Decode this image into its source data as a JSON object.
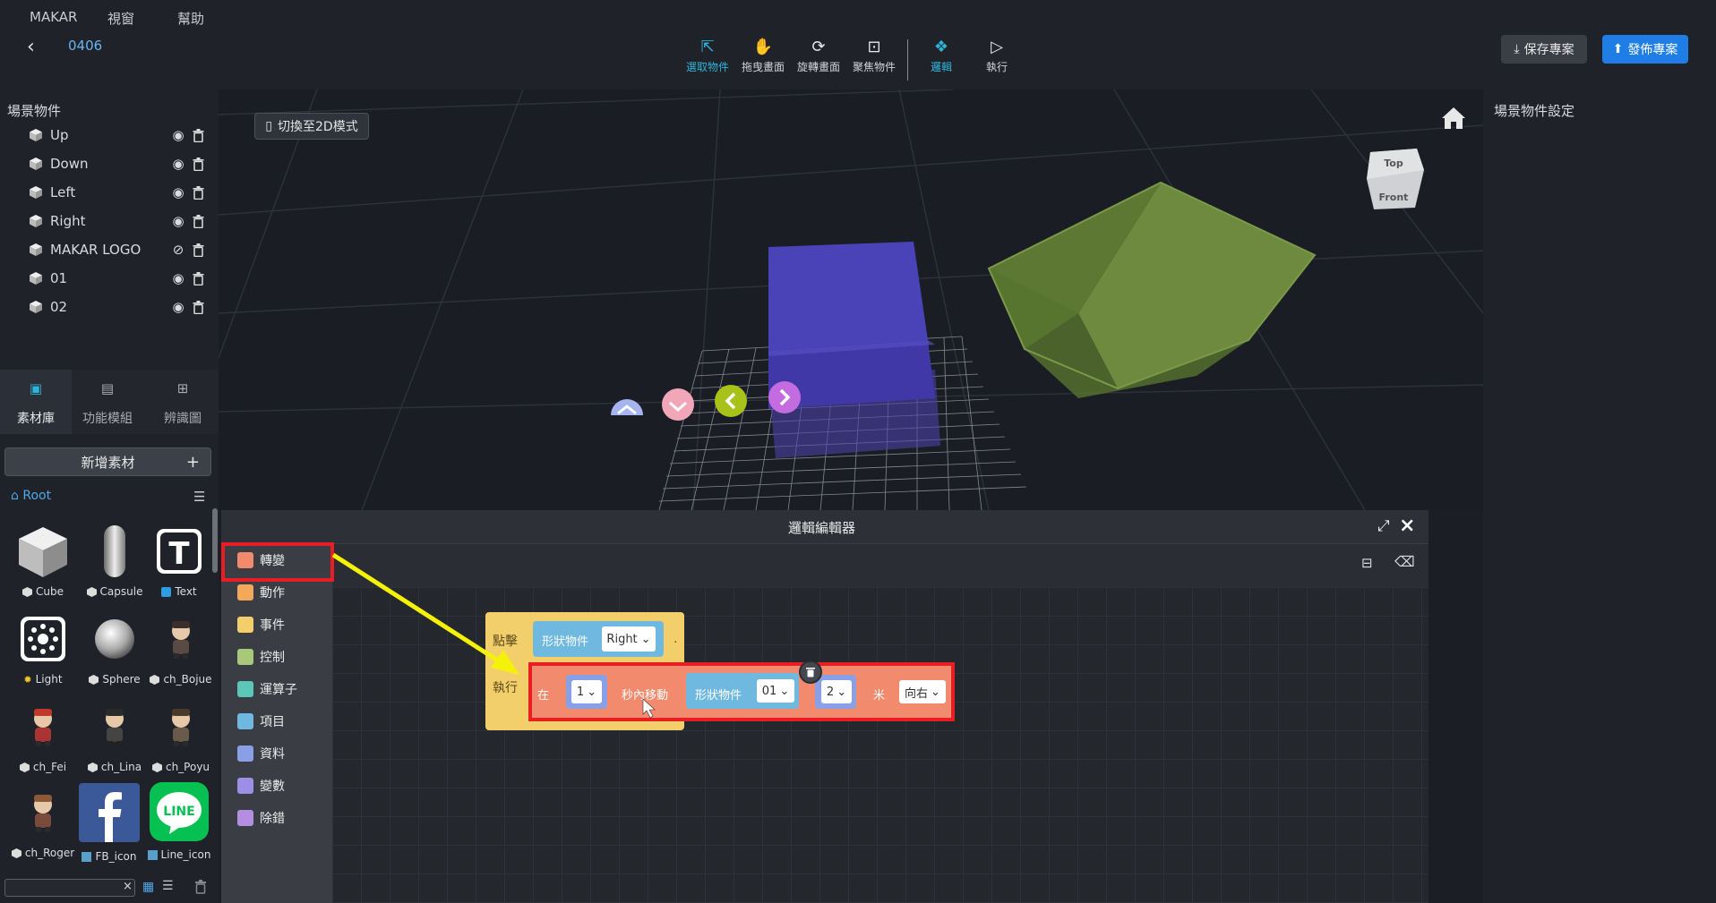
{
  "menu": [
    "MAKAR",
    "視窗",
    "幫助"
  ],
  "project": {
    "name": "0406"
  },
  "toolbar": {
    "tools": [
      {
        "label": "選取物件",
        "icon": "cursor-icon",
        "active": true
      },
      {
        "label": "拖曳畫面",
        "icon": "hand-icon"
      },
      {
        "label": "旋轉畫面",
        "icon": "rotate-icon"
      },
      {
        "label": "聚焦物件",
        "icon": "focus-icon"
      },
      {
        "label": "邏輯",
        "icon": "logic-icon",
        "active": true
      },
      {
        "label": "執行",
        "icon": "play-icon"
      }
    ],
    "save_label": "保存專案",
    "publish_label": "發佈專案"
  },
  "scene": {
    "title": "場景物件",
    "objects": [
      {
        "name": "Up",
        "visible": true
      },
      {
        "name": "Down",
        "visible": true
      },
      {
        "name": "Left",
        "visible": true
      },
      {
        "name": "Right",
        "visible": true
      },
      {
        "name": "MAKAR LOGO",
        "visible": false
      },
      {
        "name": "01",
        "visible": true
      },
      {
        "name": "02",
        "visible": true
      }
    ]
  },
  "library": {
    "tabs": [
      "素材庫",
      "功能模組",
      "辨識圖"
    ],
    "add_label": "新增素材",
    "root_label": "Root",
    "assets": [
      {
        "name": "Cube"
      },
      {
        "name": "Capsule"
      },
      {
        "name": "Text"
      },
      {
        "name": "Light"
      },
      {
        "name": "Sphere"
      },
      {
        "name": "ch_Bojue"
      },
      {
        "name": "ch_Fei"
      },
      {
        "name": "ch_Lina"
      },
      {
        "name": "ch_Poyu"
      },
      {
        "name": "ch_Roger"
      },
      {
        "name": "FB_icon"
      },
      {
        "name": "Line_icon"
      }
    ]
  },
  "viewport": {
    "switch_label": "切換至2D模式",
    "viewcube": {
      "top": "Top",
      "front": "Front"
    }
  },
  "properties": {
    "title": "場景物件設定"
  },
  "logic_editor": {
    "title": "邏輯編輯器",
    "categories": [
      {
        "label": "轉變",
        "color": "#f28b6e"
      },
      {
        "label": "動作",
        "color": "#f4a95a"
      },
      {
        "label": "事件",
        "color": "#f2cf6a"
      },
      {
        "label": "控制",
        "color": "#a8c87a"
      },
      {
        "label": "運算子",
        "color": "#5cc6b8"
      },
      {
        "label": "項目",
        "color": "#6fb8e0"
      },
      {
        "label": "資料",
        "color": "#8aa0e6"
      },
      {
        "label": "變數",
        "color": "#9d8ee6"
      },
      {
        "label": "除錯",
        "color": "#b48ee0"
      }
    ],
    "event_block": {
      "trigger_label": "點擊",
      "shape_label": "形狀物件",
      "shape_value": "Right",
      "exec_label": "執行"
    },
    "action_block": {
      "in_label": "在",
      "seconds": "1",
      "move_label": "秒內移動",
      "shape_label": "形狀物件",
      "shape_value": "01",
      "distance": "2",
      "unit_label": "米",
      "direction": "向右"
    }
  }
}
